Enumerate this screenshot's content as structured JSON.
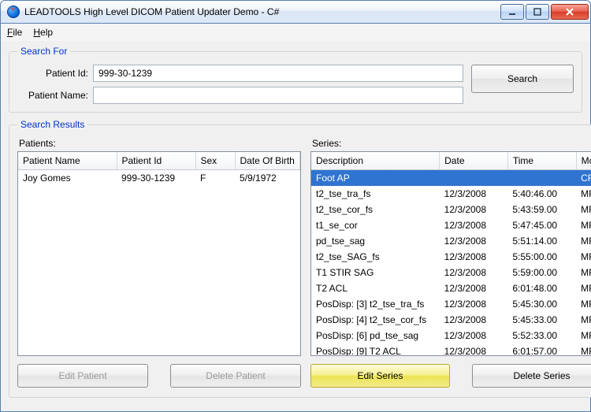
{
  "window": {
    "title": "LEADTOOLS High Level DICOM Patient Updater Demo - C#"
  },
  "menu": {
    "file": "File",
    "help": "Help"
  },
  "search": {
    "legend": "Search For",
    "patient_id_label": "Patient Id:",
    "patient_id_value": "999-30-1239",
    "patient_name_label": "Patient Name:",
    "patient_name_value": "",
    "button": "Search"
  },
  "results": {
    "legend": "Search Results",
    "patients_label": "Patients:",
    "series_label": "Series:",
    "patients_columns": [
      "Patient Name",
      "Patient Id",
      "Sex",
      "Date Of Birth"
    ],
    "patients_rows": [
      {
        "name": "Joy Gomes",
        "id": "999-30-1239",
        "sex": "F",
        "dob": "5/9/1972"
      }
    ],
    "series_columns": [
      "Description",
      "Date",
      "Time",
      "Modality"
    ],
    "series_column_short": "Mod",
    "series_rows": [
      {
        "desc": "Foot AP",
        "date": "",
        "time": "",
        "mod": "CR",
        "selected": true
      },
      {
        "desc": "t2_tse_tra_fs",
        "date": "12/3/2008",
        "time": "5:40:46.00",
        "mod": "MR"
      },
      {
        "desc": "t2_tse_cor_fs",
        "date": "12/3/2008",
        "time": "5:43:59.00",
        "mod": "MR"
      },
      {
        "desc": "t1_se_cor",
        "date": "12/3/2008",
        "time": "5:47:45.00",
        "mod": "MR"
      },
      {
        "desc": "pd_tse_sag",
        "date": "12/3/2008",
        "time": "5:51:14.00",
        "mod": "MR"
      },
      {
        "desc": "t2_tse_SAG_fs",
        "date": "12/3/2008",
        "time": "5:55:00.00",
        "mod": "MR"
      },
      {
        "desc": "T1 STIR SAG",
        "date": "12/3/2008",
        "time": "5:59:00.00",
        "mod": "MR"
      },
      {
        "desc": "T2 ACL",
        "date": "12/3/2008",
        "time": "6:01:48.00",
        "mod": "MR"
      },
      {
        "desc": "PosDisp: [3] t2_tse_tra_fs",
        "date": "12/3/2008",
        "time": "5:45:30.00",
        "mod": "MR"
      },
      {
        "desc": "PosDisp: [4] t2_tse_cor_fs",
        "date": "12/3/2008",
        "time": "5:45:33.00",
        "mod": "MR"
      },
      {
        "desc": "PosDisp: [6] pd_tse_sag",
        "date": "12/3/2008",
        "time": "5:52:33.00",
        "mod": "MR"
      },
      {
        "desc": "PosDisp: [9] T2 ACL",
        "date": "12/3/2008",
        "time": "6:01:57.00",
        "mod": "MR"
      }
    ],
    "edit_patient": "Edit Patient",
    "delete_patient": "Delete Patient",
    "edit_series": "Edit Series",
    "delete_series": "Delete Series"
  }
}
